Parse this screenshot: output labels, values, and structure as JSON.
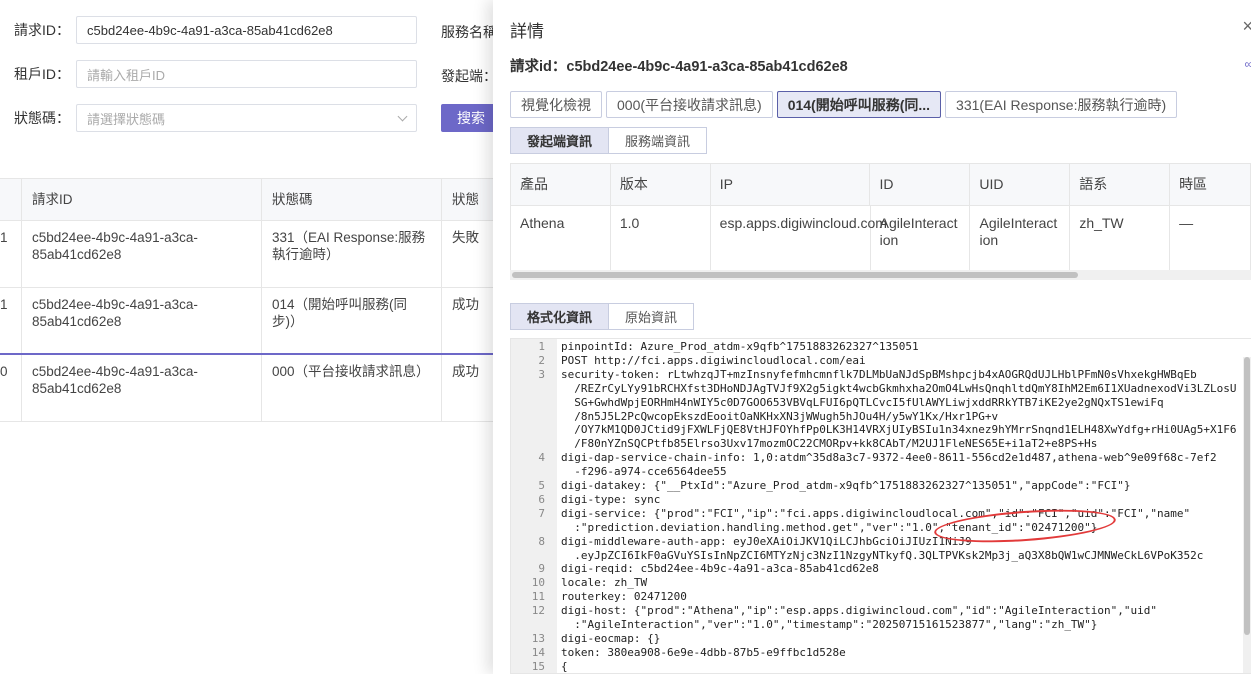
{
  "filters": {
    "request_id_label": "請求ID：",
    "request_id_value": "c5bd24ee-4b9c-4a91-a3ca-85ab41cd62e8",
    "tenant_id_label": "租戶ID：",
    "tenant_id_placeholder": "請輸入租戶ID",
    "status_label": "狀態碼：",
    "status_placeholder": "請選擇狀態碼",
    "service_name_label": "服務名稱",
    "initiator_label": "發起端：",
    "search_label": "搜索"
  },
  "bg_table": {
    "headers": [
      "",
      "請求ID",
      "狀態碼",
      "狀態"
    ],
    "rows": [
      {
        "idx": "1",
        "request_id": "c5bd24ee-4b9c-4a91-a3ca-85ab41cd62e8",
        "status_code": "331（EAI Response:服務執行逾時）",
        "status": "失敗"
      },
      {
        "idx": "1",
        "request_id": "c5bd24ee-4b9c-4a91-a3ca-85ab41cd62e8",
        "status_code": "014（開始呼叫服務(同步)）",
        "status": "成功"
      },
      {
        "idx": "0",
        "request_id": "c5bd24ee-4b9c-4a91-a3ca-85ab41cd62e8",
        "status_code": "000（平台接收請求訊息）",
        "status": "成功"
      }
    ]
  },
  "drawer": {
    "title": "詳情",
    "close_icon": "×",
    "link_icon": "∞",
    "request_id": "請求id：c5bd24ee-4b9c-4a91-a3ca-85ab41cd62e8",
    "tabs": [
      "視覺化檢視",
      "000(平台接收請求訊息)",
      "014(開始呼叫服務(同...",
      "331(EAI Response:服務執行逾時)"
    ],
    "active_tab": 2,
    "subtabs_top": [
      "發起端資訊",
      "服務端資訊"
    ],
    "info_table": {
      "headers": [
        "產品",
        "版本",
        "IP",
        "ID",
        "UID",
        "語系",
        "時區"
      ],
      "row": [
        "Athena",
        "1.0",
        "esp.apps.digiwincloud.com",
        "AgileInteraction",
        "AgileInteraction",
        "zh_TW",
        "—"
      ]
    },
    "subtabs_bottom": [
      "格式化資訊",
      "原始資訊"
    ],
    "code_lines": [
      {
        "n": "1",
        "t": "pinpointId: Azure_Prod_atdm-x9qfb^1751883262327^135051"
      },
      {
        "n": "2",
        "t": "POST http://fci.apps.digiwincloudlocal.com/eai"
      },
      {
        "n": "3",
        "t": "security-token: rLtwhzqJT+mzInsnyfefmhcmnflk7DLMbUaNJdSpBMshpcjb4xAOGRQdUJLHblPFmN0sVhxekgHWBqEb"
      },
      {
        "n": "",
        "t": "  /REZrCyLYy91bRCHXfst3DHoNDJAgTVJf9X2g5igkt4wcbGkmhxha2OmO4LwHsQnqhltdQmY8IhM2Em6I1XUadnexodVi3LZLosU"
      },
      {
        "n": "",
        "t": "  SG+GwhdWpjEORHmH4nWIY5c0D7GOO653VBVqLFUI6pQTLCvcI5fUlAWYLiwjxddRRkYTB7iKE2ye2gNQxTS1ewiFq"
      },
      {
        "n": "",
        "t": "  /8n5J5L2PcQwcopEkszdEooitOaNKHxXN3jWWugh5hJOu4H/y5wY1Kx/Hxr1PG+v"
      },
      {
        "n": "",
        "t": "  /OY7kM1QD0JCtid9jFXWLFjQE8VtHJFOYhfPp0LK3H14VRXjUIyBSIu1n34xnez9hYMrrSnqnd1ELH48XwYdfg+rHi0UAg5+X1F6"
      },
      {
        "n": "",
        "t": "  /F80nYZnSQCPtfb85Elrso3Uxv17mozmOC22CMORpv+kk8CAbT/M2UJ1FleNES65E+i1aT2+e8PS+Hs"
      },
      {
        "n": "4",
        "t": "digi-dap-service-chain-info: 1,0:atdm^35d8a3c7-9372-4ee0-8611-556cd2e1d487,athena-web^9e09f68c-7ef2"
      },
      {
        "n": "",
        "t": "  -f296-a974-cce6564dee55"
      },
      {
        "n": "5",
        "t": "digi-datakey: {\"__PtxId\":\"Azure_Prod_atdm-x9qfb^1751883262327^135051\",\"appCode\":\"FCI\"}"
      },
      {
        "n": "6",
        "t": "digi-type: sync"
      },
      {
        "n": "7",
        "t": "digi-service: {\"prod\":\"FCI\",\"ip\":\"fci.apps.digiwincloudlocal.com\",\"id\":\"FCI\",\"uid\":\"FCI\",\"name\""
      },
      {
        "n": "",
        "t": "  :\"prediction.deviation.handling.method.get\",\"ver\":\"1.0\",\"tenant_id\":\"02471200\"}"
      },
      {
        "n": "8",
        "t": "digi-middleware-auth-app: eyJ0eXAiOiJKV1QiLCJhbGciOiJIUzI1NiJ9"
      },
      {
        "n": "",
        "t": "  .eyJpZCI6IkF0aGVuYSIsInNpZCI6MTYzNjc3NzI1NzgyNTkyfQ.3QLTPVKsk2Mp3j_aQ3X8bQW1wCJMNWeCkL6VPoK352c"
      },
      {
        "n": "9",
        "t": "digi-reqid: c5bd24ee-4b9c-4a91-a3ca-85ab41cd62e8"
      },
      {
        "n": "10",
        "t": "locale: zh_TW"
      },
      {
        "n": "11",
        "t": "routerkey: 02471200"
      },
      {
        "n": "12",
        "t": "digi-host: {\"prod\":\"Athena\",\"ip\":\"esp.apps.digiwincloud.com\",\"id\":\"AgileInteraction\",\"uid\""
      },
      {
        "n": "",
        "t": "  :\"AgileInteraction\",\"ver\":\"1.0\",\"timestamp\":\"20250715161523877\",\"lang\":\"zh_TW\"}"
      },
      {
        "n": "13",
        "t": "digi-eocmap: {}"
      },
      {
        "n": "14",
        "t": "token: 380ea908-6e9e-4dbb-87b5-e9ffbc1d528e"
      },
      {
        "n": "15",
        "t": "{"
      }
    ]
  }
}
